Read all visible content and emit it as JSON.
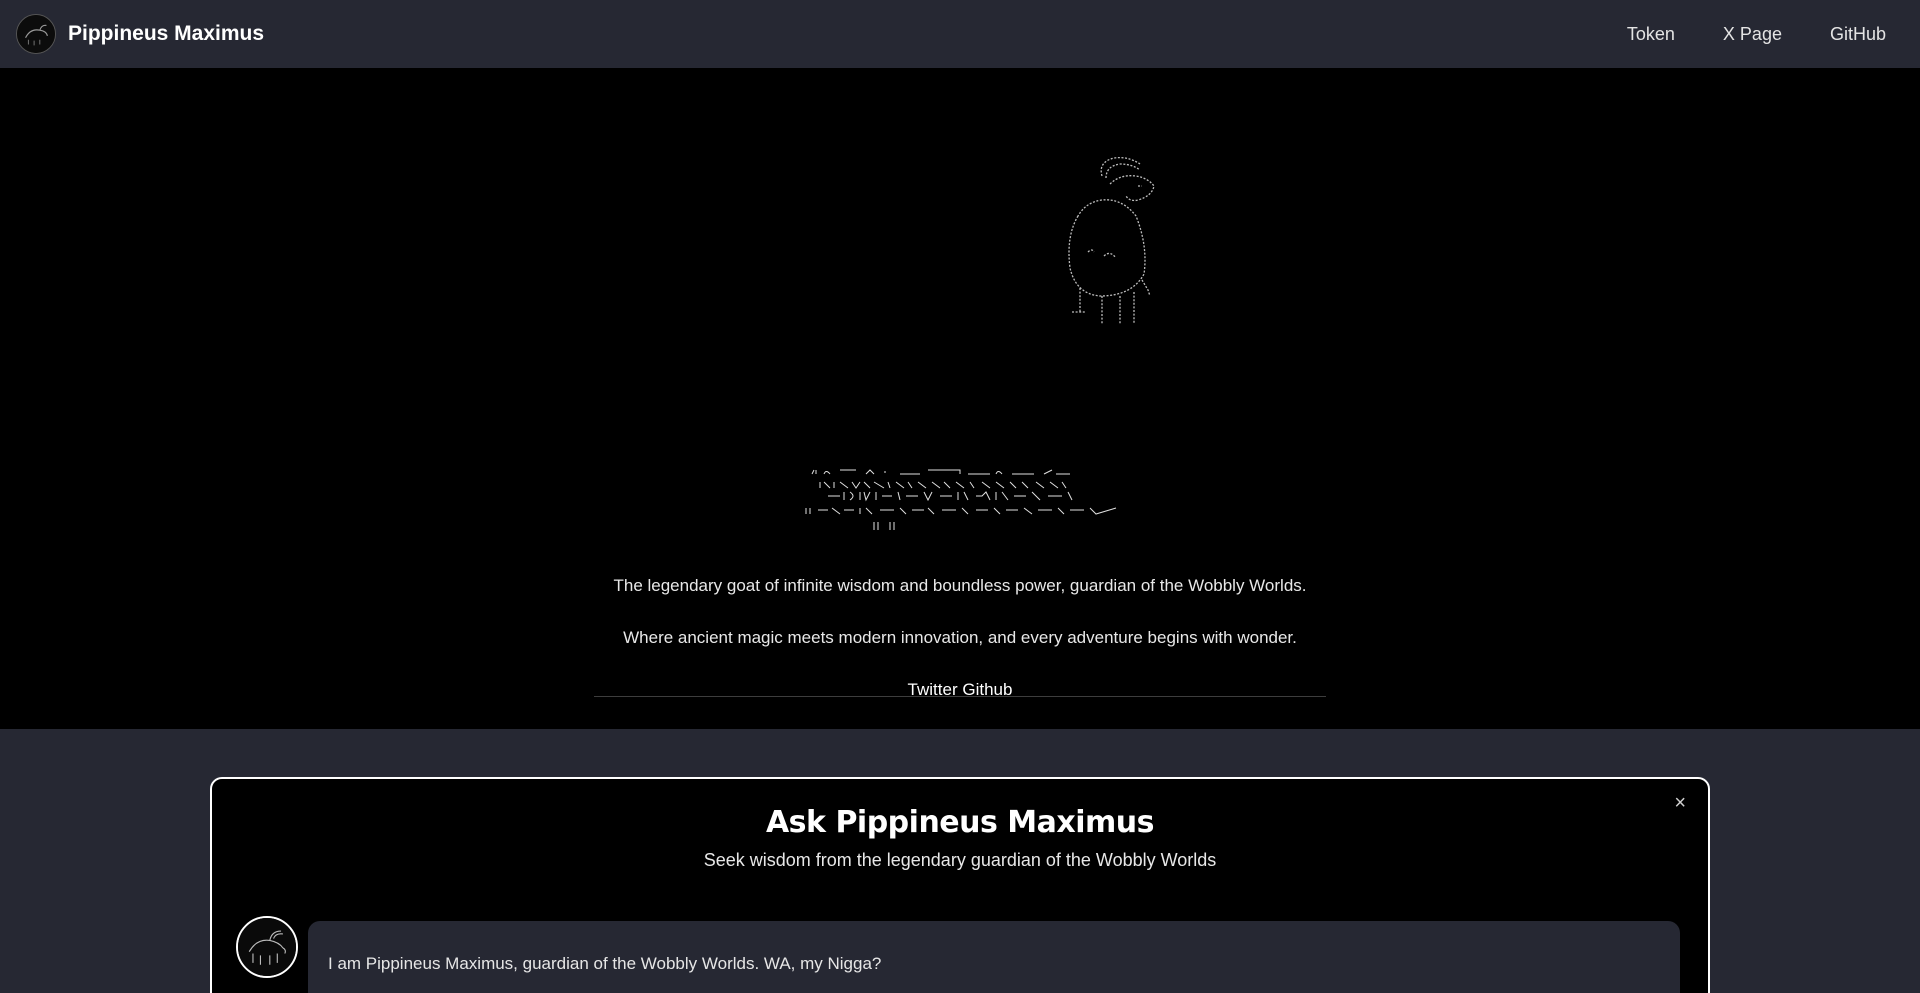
{
  "navbar": {
    "brand": "Pippineus Maximus",
    "links": [
      "Token",
      "X Page",
      "GitHub"
    ]
  },
  "hero": {
    "tagline_1": "The legendary goat of infinite wisdom and boundless power, guardian of the Wobbly Worlds.",
    "tagline_2": "Where ancient magic meets modern innovation, and every adventure begins with wonder.",
    "social_links": [
      "Twitter",
      "Github"
    ]
  },
  "chat": {
    "title": "Ask Pippineus Maximus",
    "subtitle": "Seek wisdom from the legendary guardian of the Wobbly Worlds",
    "close_symbol": "×",
    "messages": [
      {
        "role": "assistant",
        "text": "I am Pippineus Maximus, guardian of the Wobbly Worlds. WA, my Nigga?"
      }
    ]
  },
  "colors": {
    "navbar_bg": "#262833",
    "hero_bg": "#000000",
    "panel_border": "#ffffff",
    "bubble_bg": "#262833"
  },
  "icons": {
    "logo": "goat-logo-icon",
    "close": "close-icon",
    "avatar": "goat-avatar-icon"
  }
}
